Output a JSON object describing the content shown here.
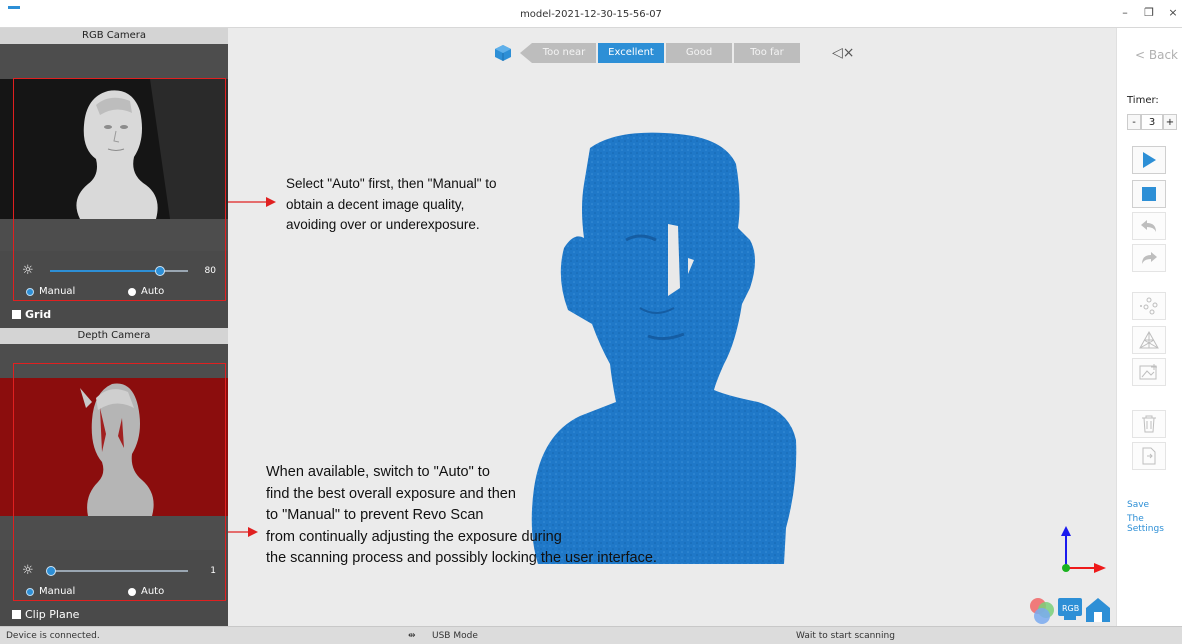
{
  "window": {
    "title": "model-2021-12-30-15-56-07",
    "minimize": "–",
    "maximize": "❐",
    "close": "×"
  },
  "left_panel": {
    "rgb_camera": {
      "header": "RGB Camera",
      "exposure_value": "80",
      "exposure_level": 0.8,
      "mode_manual": "Manual",
      "mode_auto": "Auto",
      "selected_mode": "Manual",
      "grid_label": "Grid"
    },
    "depth_camera": {
      "header": "Depth Camera",
      "exposure_value": "1",
      "exposure_level": 0.01,
      "mode_manual": "Manual",
      "mode_auto": "Auto",
      "selected_mode": "Manual",
      "clip_plane_label": "Clip Plane"
    }
  },
  "quality_bar": {
    "segments": [
      "Too near",
      "Excellent",
      "Good",
      "Too far"
    ],
    "active": "Excellent"
  },
  "annotations": {
    "rgb": [
      "Select \"Auto\" first, then \"Manual\" to",
      "obtain a decent image quality,",
      "avoiding over or underexposure."
    ],
    "depth": [
      "When available, switch to \"Auto\" to",
      "find the best overall exposure and then",
      "to \"Manual\" to prevent  Revo Scan",
      "from continually adjusting the exposure during",
      "the scanning process and possibly locking the user interface."
    ]
  },
  "right_panel": {
    "back_label": "< Back",
    "timer_label": "Timer:",
    "timer_minus": "-",
    "timer_value": "3",
    "timer_plus": "+",
    "save_line1": "Save",
    "save_line2": "The Settings"
  },
  "status_bar": {
    "device": "Device is connected.",
    "usb": "USB Mode",
    "scan": "Wait to start scanning"
  },
  "colors": {
    "accent": "#2d8fd6",
    "scan_model": "#1f78c8",
    "annotation_box": "#e02020",
    "depth_background": "#8b0d0d"
  },
  "icons": [
    "cube-icon",
    "mute-icon",
    "play-icon",
    "stop-icon",
    "undo-icon",
    "redo-icon",
    "point-cloud-icon",
    "mesh-icon",
    "texture-icon",
    "trash-icon",
    "export-icon",
    "usb-icon",
    "color-icon",
    "rgb-icon",
    "home-icon"
  ]
}
